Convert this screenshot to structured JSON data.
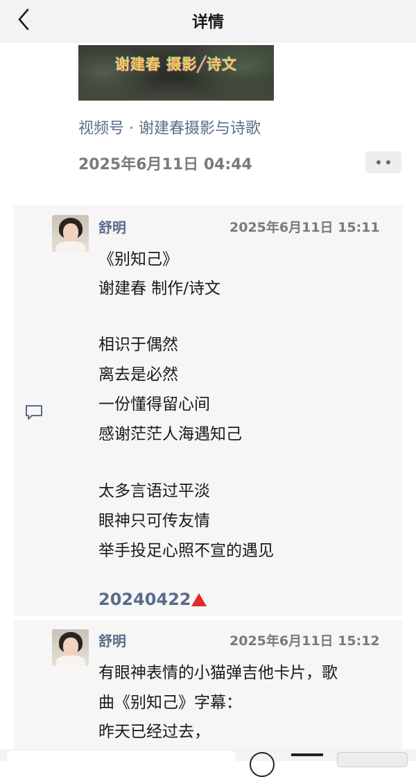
{
  "nav": {
    "title": "详情"
  },
  "post": {
    "thumbnail_text": "谢建春 摄影╱诗文",
    "channel": "视频号 · 谢建春摄影与诗歌",
    "time": "2025年6月11日 04:44"
  },
  "comments": [
    {
      "name": "舒明",
      "time": "2025年6月11日 15:11",
      "lines": [
        "《别知己》",
        "谢建春 制作/诗文",
        "相识于偶然",
        "离去是必然",
        "一份懂得留心间",
        "感谢茫茫人海遇知己",
        "太多言语过平淡",
        "眼神只可传友情",
        "举手投足心照不宣的遇见"
      ],
      "tag": "20240422"
    },
    {
      "name": "舒明",
      "time": "2025年6月11日 15:12",
      "lines": [
        "有眼神表情的小猫弹吉他卡片，歌",
        "曲《别知己》字幕：",
        "昨天已经过去，"
      ]
    }
  ],
  "colors": {
    "link": "#5b6b8c",
    "tag_marker": "#e02b2b",
    "comment_bg": "#f6f6f6"
  },
  "icons": {
    "back": "chevron-left-icon",
    "more": "more-dots-icon",
    "comment": "comment-icon"
  }
}
